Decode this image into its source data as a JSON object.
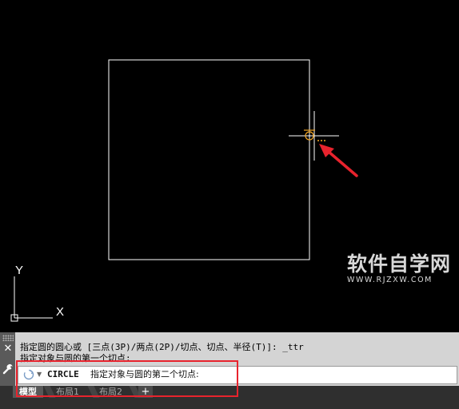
{
  "canvas": {
    "background": "#000000",
    "ucs": {
      "y_label": "Y",
      "x_label": "X"
    },
    "cursor": {
      "snap_marker_color": "#f5a623",
      "snap_indicator": "..."
    },
    "annotation_arrow_color": "#e8232d"
  },
  "watermark": {
    "text": "软件自学网",
    "url": "WWW.RJZXW.COM"
  },
  "command": {
    "history": [
      "指定圆的圆心或 [三点(3P)/两点(2P)/切点、切点、半径(T)]: _ttr",
      "指定对象与圆的第一个切点:"
    ],
    "input": {
      "command_name": "CIRCLE",
      "prompt": "指定对象与圆的第二个切点:"
    },
    "side_icons": [
      "grip-icon",
      "close-icon",
      "wrench-icon"
    ]
  },
  "tabs": [
    {
      "label": "模型",
      "active": true
    },
    {
      "label": "布局1",
      "active": false
    },
    {
      "label": "布局2",
      "active": false
    }
  ],
  "tab_add_label": "+",
  "highlight_color": "#e8232d"
}
